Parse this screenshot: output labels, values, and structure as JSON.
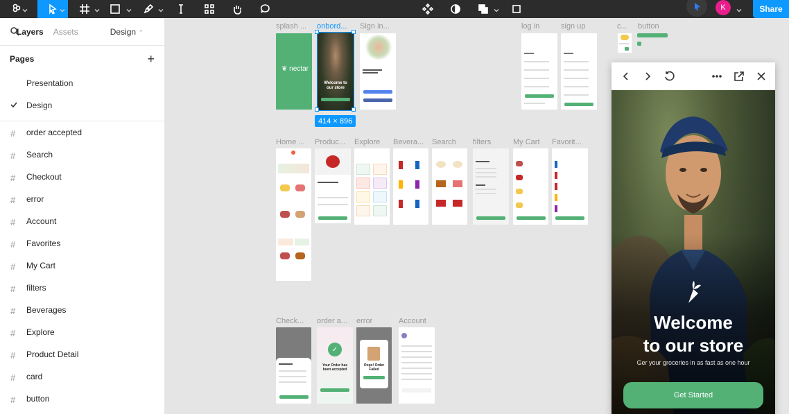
{
  "toolbar": {
    "share_label": "Share",
    "avatar_initial": "K"
  },
  "left_panel": {
    "tabs": {
      "layers": "Layers",
      "assets": "Assets",
      "design": "Design"
    },
    "pages_title": "Pages",
    "pages": [
      "Presentation",
      "Design"
    ],
    "selected_page": "Design",
    "layers": [
      "order accepted",
      "Search",
      "Checkout",
      "error",
      "Account",
      "Favorites",
      "My Cart",
      "filters",
      "Beverages",
      "Explore",
      "Product Detail",
      "card",
      "button"
    ]
  },
  "canvas": {
    "frames": [
      {
        "label": "splash ..."
      },
      {
        "label": "onbord..."
      },
      {
        "label": "Sign in..."
      },
      {
        "label": "log in"
      },
      {
        "label": "sign up"
      },
      {
        "label": "c..."
      },
      {
        "label": "button"
      },
      {
        "label": "Home ..."
      },
      {
        "label": "Produc..."
      },
      {
        "label": "Explore"
      },
      {
        "label": "Bevera..."
      },
      {
        "label": "Search"
      },
      {
        "label": "filters"
      },
      {
        "label": "My Cart"
      },
      {
        "label": "Favorit..."
      },
      {
        "label": "Check..."
      },
      {
        "label": "order a..."
      },
      {
        "label": "error"
      },
      {
        "label": "Account"
      }
    ],
    "selection_size": "414 × 896",
    "splash_logo_text": "nectar",
    "onboarding_title": "Welcome to our store",
    "order_accepted_text": "Your Order has been accepted",
    "error_text": "Oops! Order Failed"
  },
  "preview": {
    "title_line1": "Welcome",
    "title_line2": "to our store",
    "subtitle": "Ger your groceries in as fast as one hour",
    "button_label": "Get Started"
  },
  "colors": {
    "figma_blue": "#0d99ff",
    "accent_green": "#53b175",
    "toolbar_bg": "#2c2c2c",
    "canvas_bg": "#e5e5e5"
  },
  "icons": [
    "figma-menu-icon",
    "move-tool-icon",
    "frame-tool-icon",
    "shape-tool-icon",
    "pen-tool-icon",
    "text-tool-icon",
    "resources-icon",
    "hand-tool-icon",
    "comment-icon",
    "components-icon",
    "contrast-icon",
    "boolean-icon",
    "crop-icon",
    "back-icon",
    "forward-icon",
    "restart-icon",
    "more-icon",
    "open-external-icon",
    "close-icon"
  ]
}
